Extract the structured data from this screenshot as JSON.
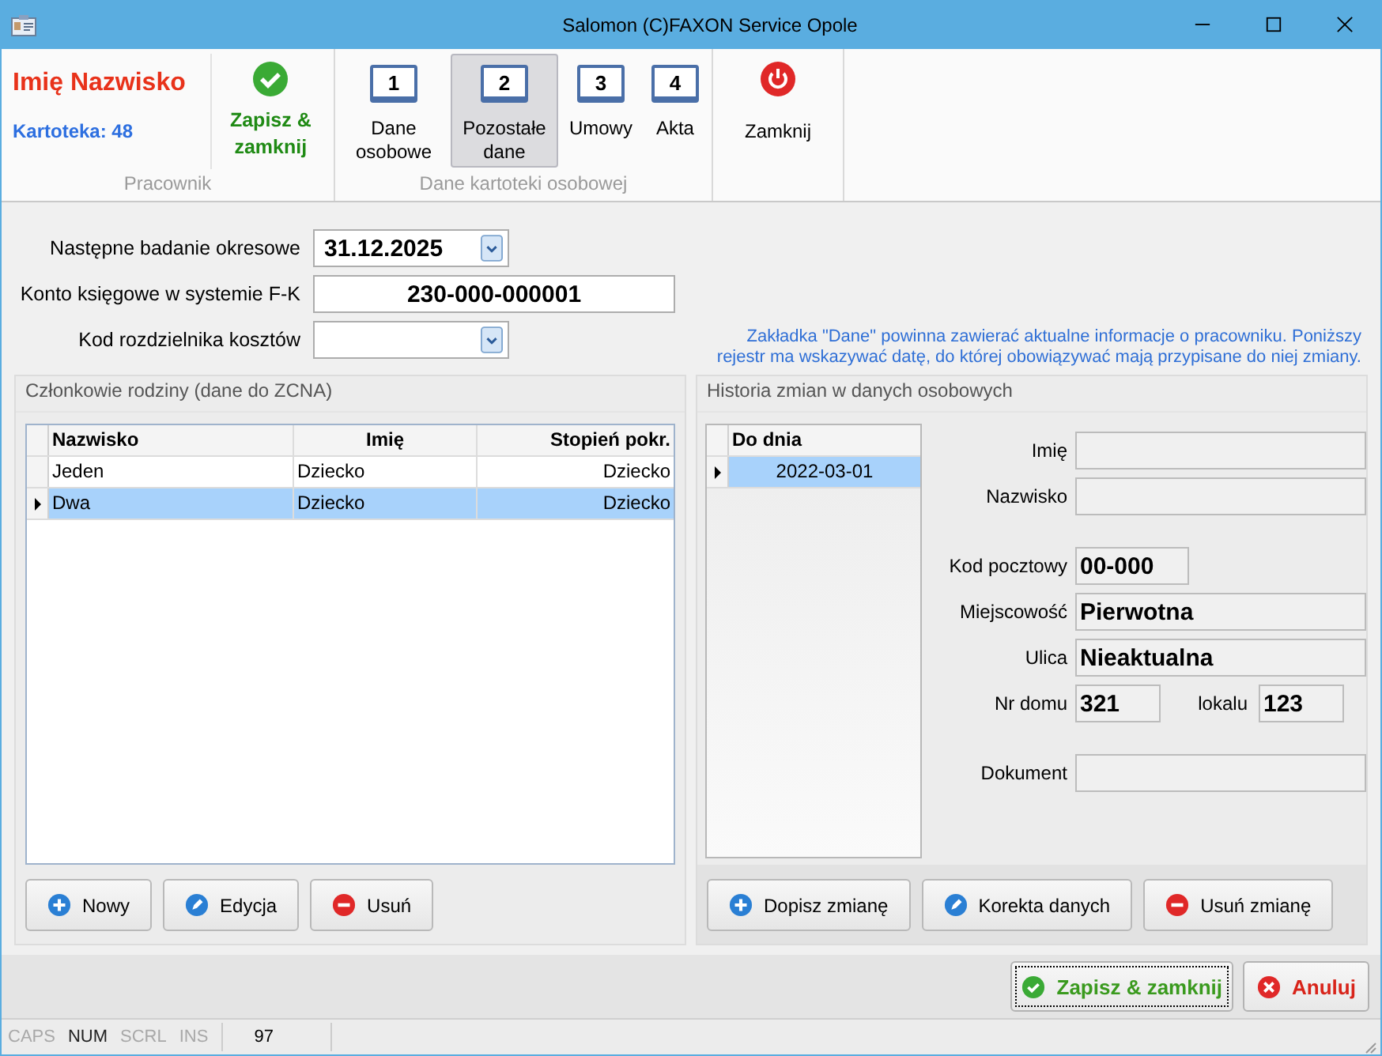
{
  "window": {
    "title": "Salomon (C)FAXON Service Opole"
  },
  "ribbon": {
    "employee_name": "Imię Nazwisko",
    "file_number": "Kartoteka: 48",
    "groups": [
      {
        "label": "Pracownik",
        "save_button": "Zapisz & zamknij"
      },
      {
        "label": "Dane kartoteki osobowej",
        "tabs": [
          {
            "number": "1",
            "label": "Dane osobowe",
            "selected": false
          },
          {
            "number": "2",
            "label": "Pozostałe dane",
            "selected": true
          },
          {
            "number": "3",
            "label": "Umowy",
            "selected": false
          },
          {
            "number": "4",
            "label": "Akta",
            "selected": false
          }
        ]
      },
      {
        "close_button": "Zamknij"
      }
    ]
  },
  "form": {
    "fields": [
      {
        "kind": "date",
        "label": "Następne badanie okresowe",
        "value": "31.12.2025"
      },
      {
        "kind": "text",
        "label": "Konto księgowe w systemie F-K",
        "value": "230-000-000001"
      },
      {
        "kind": "combo",
        "label": "Kod rozdzielnika kosztów"
      }
    ],
    "note": "Zakładka \"Dane\" powinna zawierać aktualne informacje o pracowniku. Poniższy rejestr ma wskazywać datę, do której obowiązywać mają przypisane do niej zmiany."
  },
  "family_panel": {
    "title": "Członkowie rodziny (dane do ZCNA)",
    "table": {
      "columns": [
        "Nazwisko",
        "Imię",
        "Stopień pokr."
      ],
      "rows": [
        {
          "cells": [
            "Jeden",
            "Dziecko",
            "Dziecko"
          ],
          "selected": false
        },
        {
          "cells": [
            "Dwa",
            "Dziecko",
            "Dziecko"
          ],
          "selected": true
        }
      ]
    },
    "buttons": [
      {
        "kind": "add",
        "label": "Nowy"
      },
      {
        "kind": "edit",
        "label": "Edycja"
      },
      {
        "kind": "delete",
        "label": "Usuń"
      }
    ]
  },
  "history_panel": {
    "title": "Historia zmian w danych osobowych",
    "table": {
      "column": "Do dnia",
      "rows": [
        {
          "date": "2022-03-01",
          "selected": true
        }
      ]
    },
    "detail_groups": [
      [
        {
          "kind": "wide",
          "label": "Imię"
        },
        {
          "kind": "wide",
          "label": "Nazwisko"
        }
      ],
      [
        {
          "kind": "short",
          "label": "Kod pocztowy",
          "value": "00-000"
        },
        {
          "kind": "wide",
          "label": "Miejscowość",
          "value": "Pierwotna"
        },
        {
          "kind": "wide",
          "label": "Ulica",
          "value": "Nieaktualna"
        },
        {
          "kind": "pair",
          "label": "Nr domu",
          "value": "321",
          "second_label": "lokalu",
          "second_value": "123"
        }
      ],
      [
        {
          "kind": "wide",
          "label": "Dokument"
        }
      ]
    ],
    "buttons": [
      {
        "kind": "add",
        "label": "Dopisz zmianę"
      },
      {
        "kind": "edit",
        "label": "Korekta danych"
      },
      {
        "kind": "delete",
        "label": "Usuń zmianę"
      }
    ]
  },
  "footer_buttons": [
    {
      "kind": "save",
      "label": "Zapisz & zamknij"
    },
    {
      "kind": "cancel",
      "label": "Anuluj"
    }
  ],
  "status_bar": {
    "keys": [
      {
        "label": "CAPS",
        "on": false
      },
      {
        "label": "NUM",
        "on": true
      },
      {
        "label": "SCRL",
        "on": false
      },
      {
        "label": "INS",
        "on": false
      }
    ],
    "count": "97"
  }
}
